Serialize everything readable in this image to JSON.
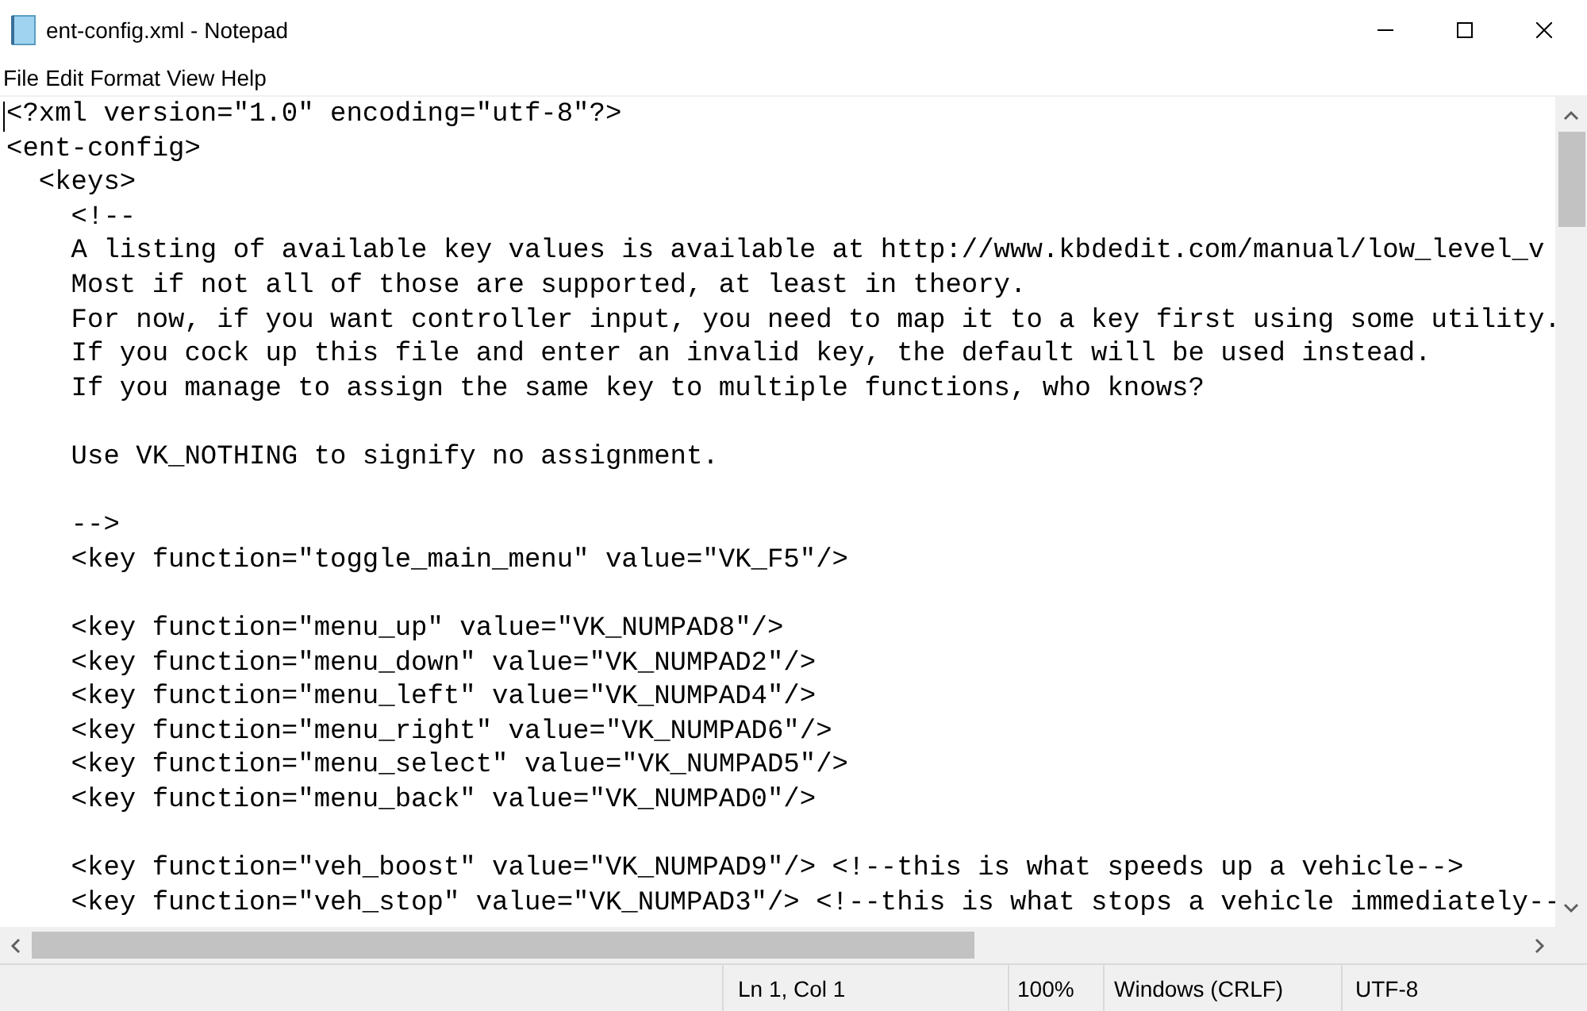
{
  "window": {
    "title": "ent-config.xml - Notepad"
  },
  "menu": [
    "File",
    "Edit",
    "Format",
    "View",
    "Help"
  ],
  "editor": {
    "lines": [
      {
        "kind": "text",
        "text": "<?xml version=\"1.0\" encoding=\"utf-8\"?>"
      },
      {
        "kind": "text",
        "text": "<ent-config>"
      },
      {
        "kind": "text",
        "text": "  <keys>"
      },
      {
        "kind": "text",
        "text": "    <!--"
      },
      {
        "kind": "text",
        "text": "    A listing of available key values is available at http://www.kbdedit.com/manual/low_level_v"
      },
      {
        "kind": "text",
        "text": "    Most if not all of those are supported, at least in theory."
      },
      {
        "kind": "text",
        "text": "    For now, if you want controller input, you need to map it to a key first using some utility."
      },
      {
        "kind": "text",
        "text": "    If you cock up this file and enter an invalid key, the default will be used instead."
      },
      {
        "kind": "text",
        "text": "    If you manage to assign the same key to multiple functions, who knows?"
      },
      {
        "kind": "blank"
      },
      {
        "kind": "text",
        "text": "    Use VK_NOTHING to signify no assignment."
      },
      {
        "kind": "blank"
      },
      {
        "kind": "text",
        "text": "    -->"
      },
      {
        "kind": "text",
        "text": "    <key function=\"toggle_main_menu\" value=\"VK_F5\"/>"
      },
      {
        "kind": "blank"
      },
      {
        "kind": "text",
        "text": "    <key function=\"menu_up\" value=\"VK_NUMPAD8\"/>"
      },
      {
        "kind": "text",
        "text": "    <key function=\"menu_down\" value=\"VK_NUMPAD2\"/>"
      },
      {
        "kind": "text",
        "text": "    <key function=\"menu_left\" value=\"VK_NUMPAD4\"/>"
      },
      {
        "kind": "text",
        "text": "    <key function=\"menu_right\" value=\"VK_NUMPAD6\"/>"
      },
      {
        "kind": "text",
        "text": "    <key function=\"menu_select\" value=\"VK_NUMPAD5\"/>"
      },
      {
        "kind": "text",
        "text": "    <key function=\"menu_back\" value=\"VK_NUMPAD0\"/>"
      },
      {
        "kind": "blank"
      },
      {
        "kind": "text",
        "text": "    <key function=\"veh_boost\" value=\"VK_NUMPAD9\"/> <!--this is what speeds up a vehicle-->"
      },
      {
        "kind": "text",
        "text": "    <key function=\"veh_stop\" value=\"VK_NUMPAD3\"/> <!--this is what stops a vehicle immediately--"
      }
    ]
  },
  "status_bar": {
    "position": "Ln 1, Col 1",
    "zoom": "100%",
    "line_endings": "Windows (CRLF)",
    "encoding": "UTF-8"
  }
}
